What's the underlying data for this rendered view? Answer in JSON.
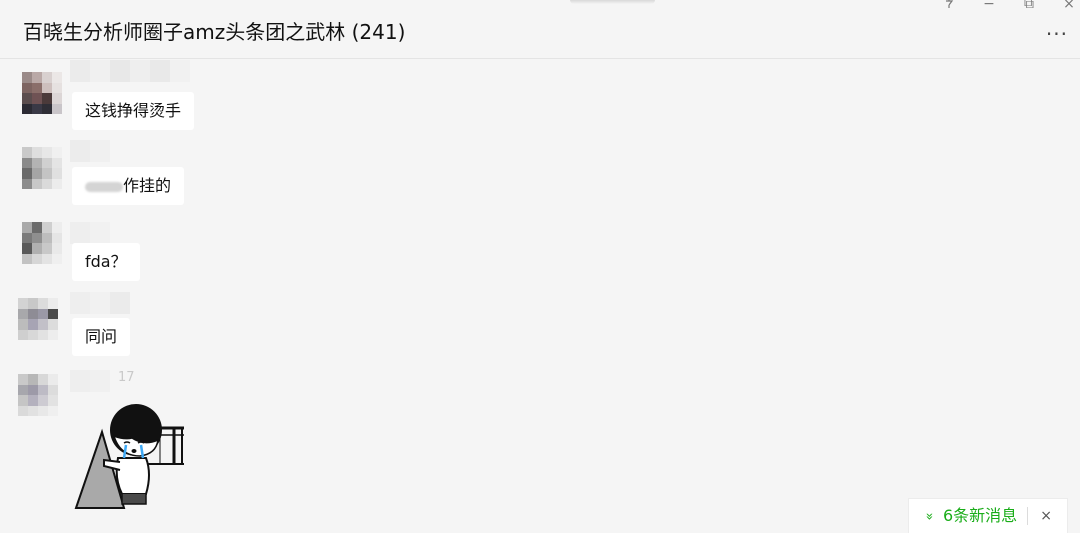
{
  "window": {
    "controls": {
      "pin_icon": "pin-icon",
      "minimize": "−",
      "restore": "⧉",
      "close": "×"
    }
  },
  "header": {
    "title": "百晓生分析师圈子amz头条团之武林 (241)",
    "more_label": "···"
  },
  "messages": [
    {
      "text": "这钱挣得烫手",
      "sender_visible": false
    },
    {
      "text_suffix": "作挂的",
      "prefix_blurred": true,
      "sender_visible": false
    },
    {
      "text": "fda？",
      "sender_visible": false
    },
    {
      "text": "同问",
      "sender_visible": false
    },
    {
      "type": "sticker",
      "sticker_icon": "crying-girl-sticker",
      "time_fragment": "17"
    }
  ],
  "new_messages_bar": {
    "label": "6条新消息",
    "chevron": "»",
    "close_label": "×"
  },
  "colors": {
    "background": "#f5f5f5",
    "bubble": "#ffffff",
    "accent_green": "#1aad19"
  }
}
